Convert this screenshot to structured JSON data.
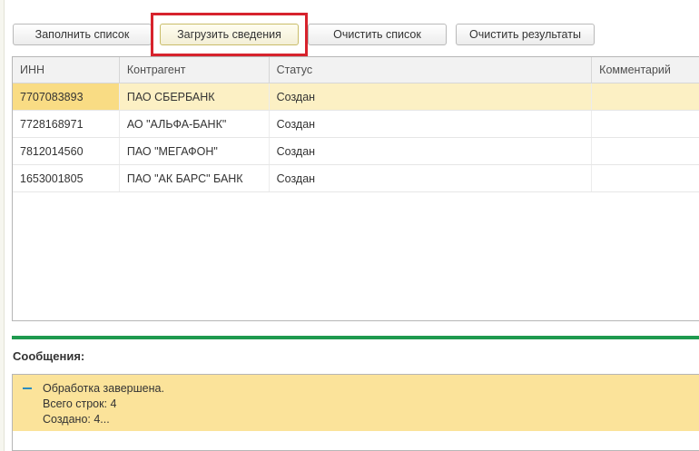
{
  "toolbar": {
    "fill_list": "Заполнить список",
    "load_info": "Загрузить сведения",
    "clear_list": "Очистить список",
    "clear_results": "Очистить результаты"
  },
  "table": {
    "columns": [
      "ИНН",
      "Контрагент",
      "Статус",
      "Комментарий"
    ],
    "rows": [
      {
        "inn": "7707083893",
        "counterparty": "ПАО СБЕРБАНК",
        "status": "Создан",
        "comment": ""
      },
      {
        "inn": "7728168971",
        "counterparty": "АО \"АЛЬФА-БАНК\"",
        "status": "Создан",
        "comment": ""
      },
      {
        "inn": "7812014560",
        "counterparty": "ПАО \"МЕГАФОН\"",
        "status": "Создан",
        "comment": ""
      },
      {
        "inn": "1653001805",
        "counterparty": "ПАО \"АК БАРС\" БАНК",
        "status": "Создан",
        "comment": ""
      }
    ],
    "selected_row": 0
  },
  "messages": {
    "title": "Сообщения:",
    "lines": [
      "Обработка завершена.",
      "Всего строк: 4",
      "Создано: 4..."
    ]
  },
  "colors": {
    "highlight": "#d7232d",
    "splitter": "#1f9a4f",
    "selected_row": "#fcf0c4",
    "message_background": "#fbe39a"
  },
  "icons": {
    "message_marker": "minus-icon"
  }
}
